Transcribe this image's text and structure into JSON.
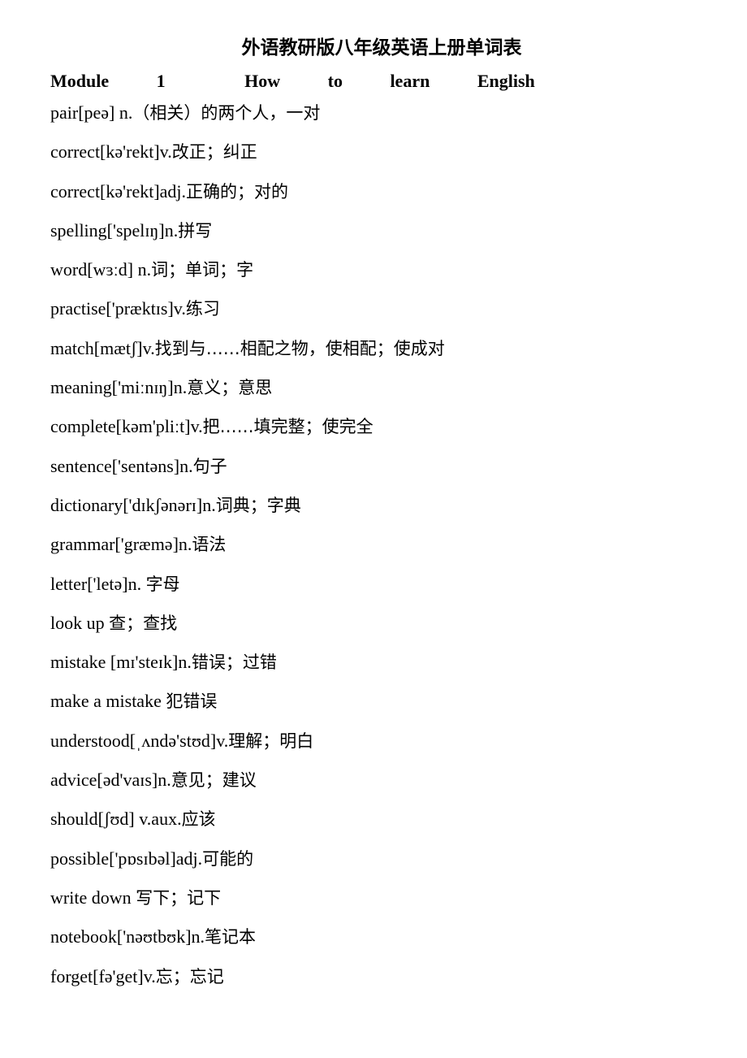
{
  "document": {
    "title": "外语教研版八年级英语上册单词表",
    "module_heading": "Module   1     How   to   learn   English",
    "entries": [
      {
        "en": "pair[peə] n.",
        "cn": "（相关）的两个人，一对"
      },
      {
        "en": "correct[kə'rekt]v.",
        "cn": "改正；纠正"
      },
      {
        "en": "correct[kə'rekt]adj.",
        "cn": "正确的；对的"
      },
      {
        "en": "spelling['spelɪŋ]n.",
        "cn": "拼写"
      },
      {
        "en": "word[wɜːd] n.",
        "cn": "词；单词；字"
      },
      {
        "en": "practise['præktɪs]v.",
        "cn": "练习"
      },
      {
        "en": "match[mætʃ]v.",
        "cn": "找到与……相配之物，使相配；使成对"
      },
      {
        "en": "meaning['miːnɪŋ]n.",
        "cn": "意义；意思"
      },
      {
        "en": "complete[kəm'pliːt]v.",
        "cn": "把……填完整；使完全"
      },
      {
        "en": "sentence['sentəns]n.",
        "cn": "句子"
      },
      {
        "en": "dictionary['dɪkʃənərɪ]n.",
        "cn": "词典；字典"
      },
      {
        "en": "grammar['græmə]n.",
        "cn": "语法"
      },
      {
        "en": "letter['letə]n.  ",
        "cn": "字母"
      },
      {
        "en": "look up ",
        "cn": "查；查找"
      },
      {
        "en": "mistake [mɪ'steɪk]n.",
        "cn": "错误；过错"
      },
      {
        "en": "make a mistake ",
        "cn": "犯错误"
      },
      {
        "en": "understood[ˌʌndə'stʊd]v.",
        "cn": "理解；明白"
      },
      {
        "en": "advice[əd'vaɪs]n.",
        "cn": "意见；建议"
      },
      {
        "en": "should[ʃʊd] v.aux.",
        "cn": "应该"
      },
      {
        "en": "possible['pɒsɪbəl]adj.",
        "cn": "可能的"
      },
      {
        "en": "write down ",
        "cn": "写下；记下"
      },
      {
        "en": "notebook['nəʊtbʊk]n.",
        "cn": "笔记本"
      },
      {
        "en": "forget[fə'get]v.",
        "cn": "忘；忘记"
      }
    ]
  }
}
